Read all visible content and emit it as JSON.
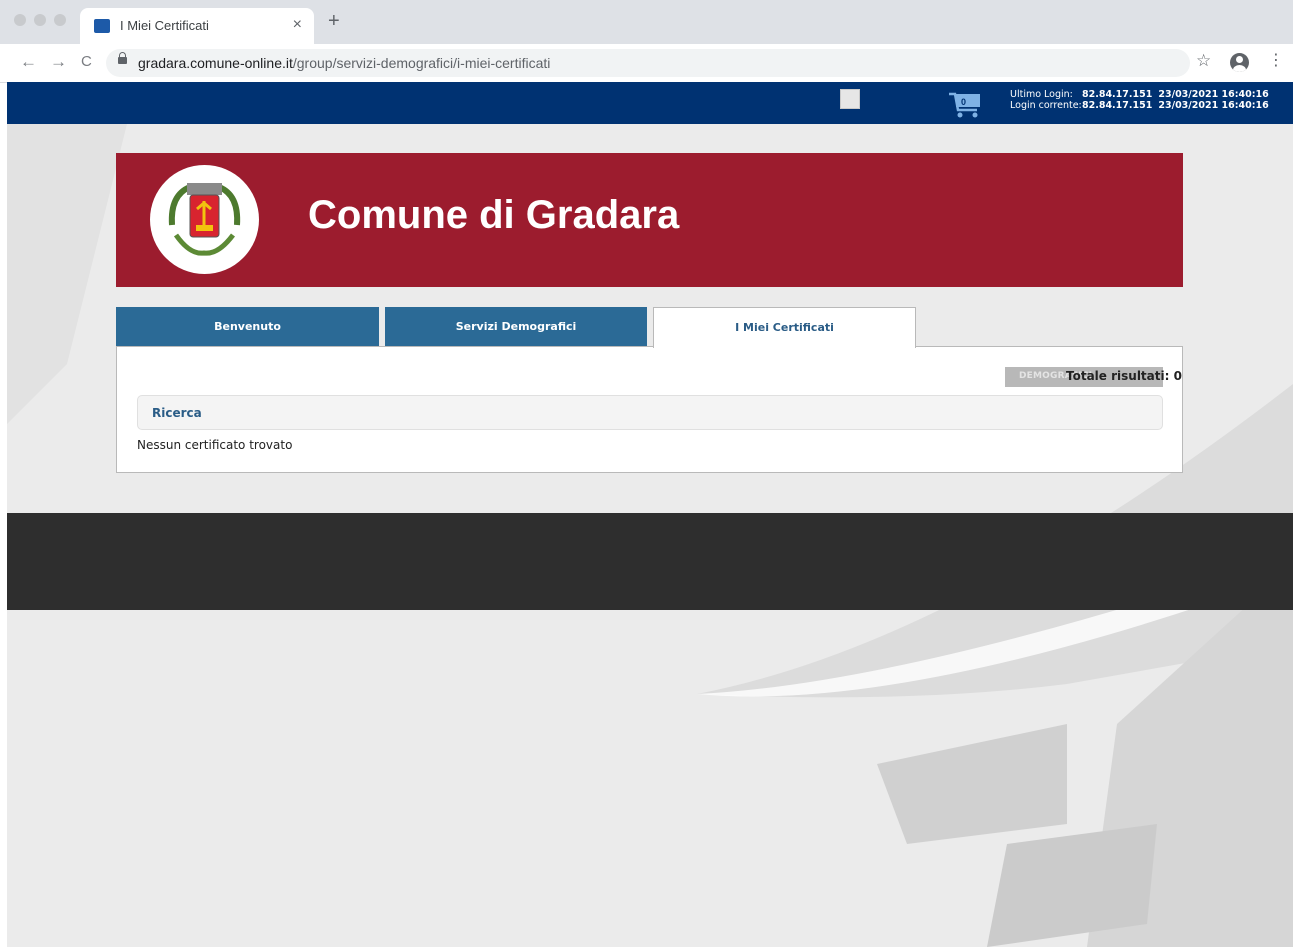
{
  "browser": {
    "tab_title": "I Miei Certificati",
    "tab_close": "×",
    "new_tab": "+",
    "url_host": "gradara.comune-online.it",
    "url_path": "/group/servizi-demografici/i-miei-certificati",
    "back": "←",
    "forward": "→",
    "reload": "C",
    "star": "☆",
    "menu": "⋮"
  },
  "topbar": {
    "cart_count": "0",
    "ultimo_login_label": "Ultimo Login:",
    "ultimo_login_ip": "82.84.17.151",
    "ultimo_login_time": "23/03/2021 16:40:16",
    "login_corrente_label": "Login corrente:",
    "login_corrente_ip": "82.84.17.151",
    "login_corrente_time": "23/03/2021 16:40:16"
  },
  "banner": {
    "title": "Comune di Gradara"
  },
  "tabs": [
    {
      "label": "Benvenuto"
    },
    {
      "label": "Servizi Demografici"
    },
    {
      "label": "I Miei Certificati"
    }
  ],
  "panel": {
    "badge_text": "DEMOGRAFICI",
    "total_results": "Totale risultati: 0",
    "search_label": "Ricerca",
    "empty_message": "Nessun certificato trovato"
  },
  "colors": {
    "topbar": "#003272",
    "banner": "#9c1c2e",
    "tab_inactive": "#2b6a96",
    "footer": "#2e2e2e"
  }
}
